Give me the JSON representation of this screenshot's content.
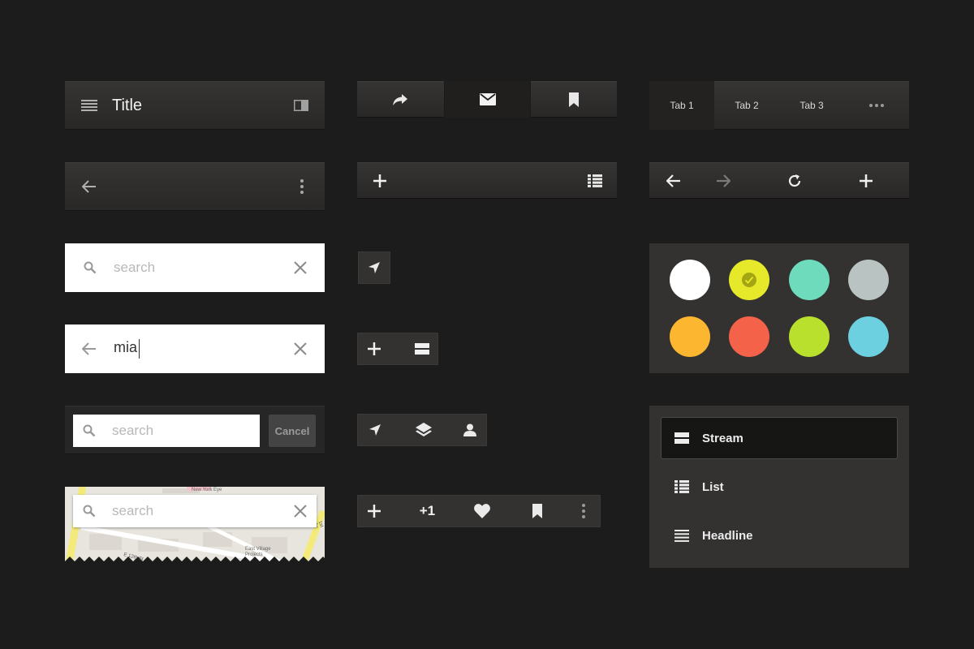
{
  "title_bar": {
    "title": "Title",
    "menu_icon": "hamburger-icon",
    "panel_icon": "sidebar-panel-icon"
  },
  "back_bar": {
    "back_icon": "arrow-left-icon",
    "more_icon": "more-vertical-icon"
  },
  "search_empty": {
    "placeholder": "search"
  },
  "search_typed": {
    "value": "mia"
  },
  "search_cancel": {
    "placeholder": "search",
    "cancel_label": "Cancel"
  },
  "map_search": {
    "placeholder": "search",
    "map_labels": [
      "New York Eye",
      "E 12th St",
      "East Village",
      "Projects",
      "1st Av"
    ]
  },
  "segment_bar": {
    "items": [
      "share-icon",
      "mail-icon",
      "bookmark-icon"
    ],
    "active_index": 1
  },
  "action_bar": {
    "left_icon": "plus-icon",
    "right_icon": "list-view-icon"
  },
  "fab_bar": {
    "plus_one": "+1"
  },
  "tabs": {
    "items": [
      "Tab 1",
      "Tab 2",
      "Tab 3"
    ],
    "active_index": 0,
    "overflow_icon": "more-horizontal-icon"
  },
  "browser_nav": {
    "icons": [
      "arrow-left-icon",
      "arrow-right-icon",
      "refresh-icon",
      "plus-icon"
    ]
  },
  "palette": {
    "colors": [
      "#ffffff",
      "#e6e82a",
      "#6edcbc",
      "#b8c3c2",
      "#fdb62f",
      "#f5624a",
      "#b8e02c",
      "#6dd0e0"
    ],
    "selected_index": 1
  },
  "view_list": {
    "items": [
      {
        "label": "Stream",
        "icon": "stream-icon"
      },
      {
        "label": "List",
        "icon": "list-view-icon"
      },
      {
        "label": "Headline",
        "icon": "headline-icon"
      }
    ],
    "selected_index": 0
  }
}
